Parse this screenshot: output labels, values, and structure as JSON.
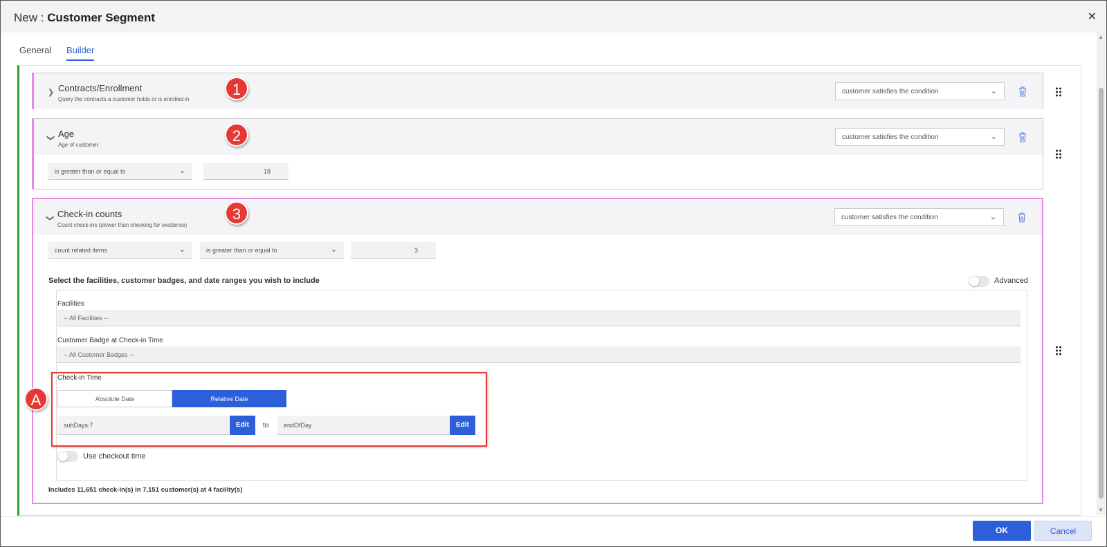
{
  "dialog": {
    "title_prefix": "New : ",
    "title_entity": "Customer Segment",
    "close_label": "✕"
  },
  "tabs": [
    {
      "label": "General",
      "active": false
    },
    {
      "label": "Builder",
      "active": true
    }
  ],
  "blocks": [
    {
      "name": "Contracts/Enrollment",
      "description": "Query the contracts a customer holds or is enrolled in",
      "condition": "customer satisfies the condition",
      "expanded": false,
      "badge": "1"
    },
    {
      "name": "Age",
      "description": "Age of customer",
      "condition": "customer satisfies the condition",
      "expanded": true,
      "badge": "2",
      "operator": "is greater than or equal to",
      "value": "18"
    },
    {
      "name": "Check-in counts",
      "description": "Count check-ins (slower than checking for existence)",
      "condition": "customer satisfies the condition",
      "expanded": true,
      "badge": "3",
      "aggregate": "count related items",
      "operator": "is greater than or equal to",
      "value": "3"
    }
  ],
  "checkin": {
    "instructions": "Select the facilities, customer badges, and date ranges you wish to include",
    "advanced_label": "Advanced",
    "facilities_label": "Facilities",
    "facilities_value": "-- All Facilities --",
    "badge_label": "Customer Badge at Check-in Time",
    "badge_value": "-- All Customer Badges --",
    "time_label": "Check-in Time",
    "absolute_label": "Absolute Date",
    "relative_label": "Relative Date",
    "from_value": "subDays:7",
    "edit_label": "Edit",
    "to_label": "to",
    "to_value": "endOfDay",
    "checkout_label": "Use checkout time",
    "summary": "Includes 11,651 check-in(s) in 7,151 customer(s) at 4 facility(s)"
  },
  "annotation_badge": "A",
  "footer": {
    "ok_label": "OK",
    "cancel_label": "Cancel"
  },
  "colors": {
    "accent": "#2c5fd9",
    "block_border": "#e48ae4",
    "group_border": "#2ca02c",
    "annotation_red": "#e53935"
  },
  "icons": [
    "close-icon",
    "chevron-right-icon",
    "chevron-down-icon",
    "trash-icon",
    "drag-handle-icon"
  ]
}
